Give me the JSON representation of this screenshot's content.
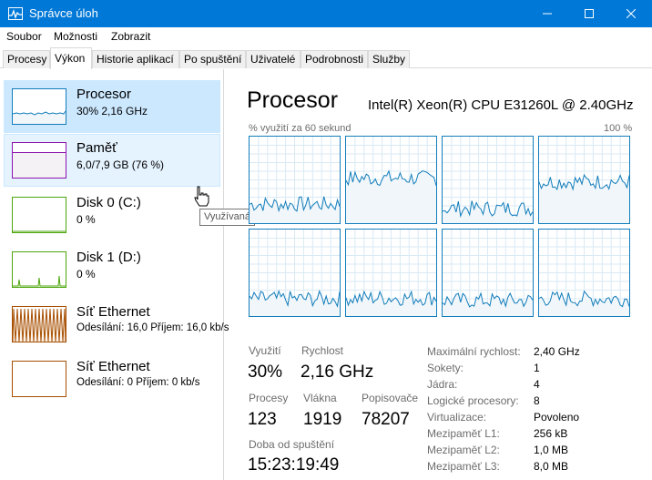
{
  "window": {
    "title": "Správce úloh"
  },
  "menu": [
    "Soubor",
    "Možnosti",
    "Zobrazit"
  ],
  "tabs": [
    "Procesy",
    "Výkon",
    "Historie aplikací",
    "Po spuštění",
    "Uživatelé",
    "Podrobnosti",
    "Služby"
  ],
  "resources": [
    {
      "name": "Procesor",
      "detail": "30% 2,16 GHz",
      "color": "#117dbb"
    },
    {
      "name": "Paměť",
      "detail": "6,0/7,9 GB (76 %)",
      "color": "#8b12ae"
    },
    {
      "name": "Disk 0 (C:)",
      "detail": "0 %",
      "color": "#4da60c"
    },
    {
      "name": "Disk 1 (D:)",
      "detail": "0 %",
      "color": "#4da60c"
    },
    {
      "name": "Síť Ethernet",
      "detail": "Odesílání: 16,0 Příjem: 16,0 kb/s",
      "color": "#a74f01"
    },
    {
      "name": "Síť Ethernet",
      "detail": "Odesílání: 0 Příjem: 0 kb/s",
      "color": "#a74f01"
    }
  ],
  "tooltip": "Využívaná",
  "main": {
    "title": "Procesor",
    "cpu_model": "Intel(R) Xeon(R) CPU E31260L @ 2.40GHz",
    "graph_label": "% využití za 60 sekund",
    "graph_max": "100 %",
    "stats": {
      "usage_label": "Využití",
      "usage_value": "30%",
      "speed_label": "Rychlost",
      "speed_value": "2,16 GHz",
      "processes_label": "Procesy",
      "processes_value": "123",
      "threads_label": "Vlákna",
      "threads_value": "1919",
      "handles_label": "Popisovače",
      "handles_value": "78207",
      "uptime_label": "Doba od spuštění",
      "uptime_value": "15:23:19:49"
    },
    "details": [
      {
        "label": "Maximální rychlost:",
        "value": "2,40 GHz"
      },
      {
        "label": "Sokety:",
        "value": "1"
      },
      {
        "label": "Jádra:",
        "value": "4"
      },
      {
        "label": "Logické procesory:",
        "value": "8"
      },
      {
        "label": "Virtualizace:",
        "value": "Povoleno"
      },
      {
        "label": "Mezipaměť L1:",
        "value": "256 kB"
      },
      {
        "label": "Mezipaměť L2:",
        "value": "1,0 MB"
      },
      {
        "label": "Mezipaměť L3:",
        "value": "8,0 MB"
      }
    ]
  }
}
